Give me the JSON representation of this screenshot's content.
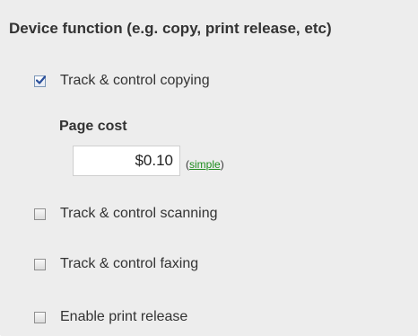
{
  "section": {
    "title": "Device function (e.g. copy, print release, etc)"
  },
  "options": [
    {
      "label": "Track & control copying",
      "checked": true
    },
    {
      "label": "Track & control scanning",
      "checked": false
    },
    {
      "label": "Track & control faxing",
      "checked": false
    },
    {
      "label": "Enable print release",
      "checked": false
    }
  ],
  "page_cost": {
    "title": "Page cost",
    "value": "$0.10",
    "mode_open": "(",
    "mode_link": "simple",
    "mode_close": ")"
  },
  "icons": {
    "checkbox_checked": "checkbox-checked-icon",
    "checkbox_unchecked": "checkbox-unchecked-icon",
    "check_mark": "check-icon"
  },
  "colors": {
    "panel_background": "#ededed",
    "text": "#333333",
    "link": "#1e8c1e",
    "check_mark": "#2a4f9a"
  }
}
